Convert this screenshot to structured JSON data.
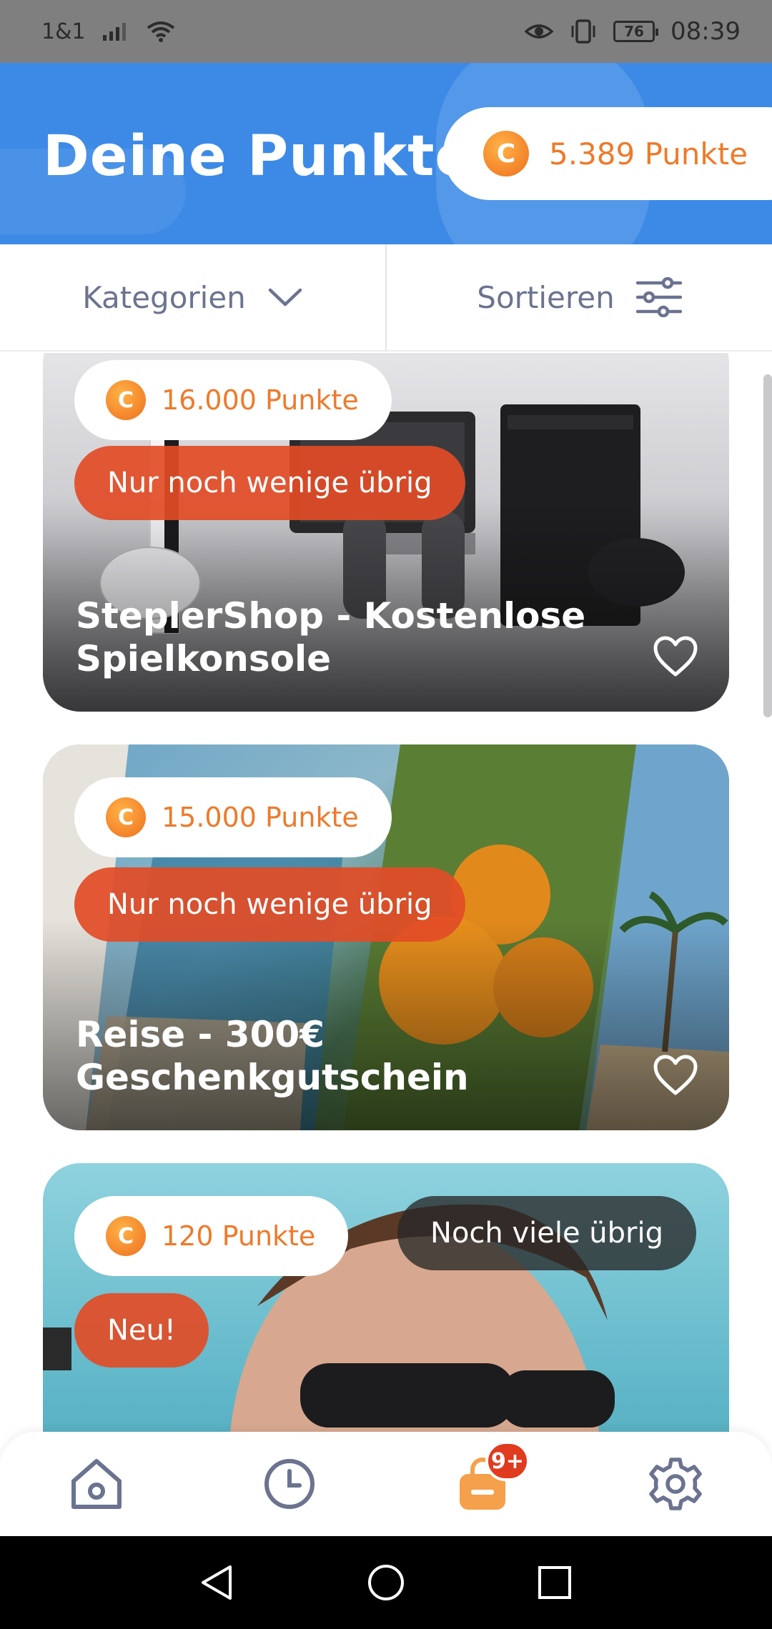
{
  "status_bar": {
    "carrier": "1&1",
    "battery": "76",
    "time": "08:39"
  },
  "header": {
    "title": "Deine Punkte:",
    "points_coin": "C",
    "points_value": "5.389 Punkte"
  },
  "filters": {
    "categories_label": "Kategorien",
    "sort_label": "Sortieren"
  },
  "cards": [
    {
      "price": "16.000 Punkte",
      "coin": "C",
      "tag": "Nur noch wenige übrig",
      "title": "SteplerShop - Kostenlose Spielkonsole"
    },
    {
      "price": "15.000 Punkte",
      "coin": "C",
      "tag": "Nur noch wenige übrig",
      "title": "Reise -  300€ Geschenkgutschein"
    },
    {
      "price": "120 Punkte",
      "coin": "C",
      "availability": "Noch viele übrig",
      "tag": "Neu!"
    }
  ],
  "bottom_nav": {
    "badge": "9+"
  },
  "colors": {
    "header_blue": "#3d8ae6",
    "points_orange": "#ee7a2b",
    "tag_red": "#e24c26",
    "nav_gray": "#6b7390",
    "nav_active": "#f5a04a"
  }
}
